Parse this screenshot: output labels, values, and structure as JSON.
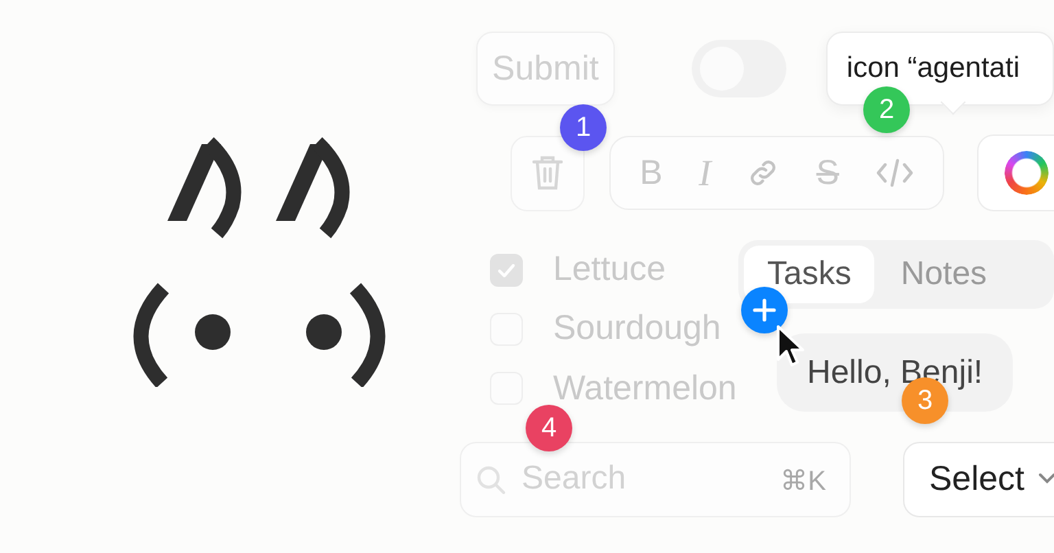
{
  "submit_button": {
    "label": "Submit"
  },
  "toggle": {
    "on": false
  },
  "tooltip": {
    "text": "icon “agentati"
  },
  "toolbar": [
    {
      "kind": "bold",
      "label": "B"
    },
    {
      "kind": "italic",
      "label": "I"
    },
    {
      "kind": "link"
    },
    {
      "kind": "strike",
      "label": "S"
    },
    {
      "kind": "code"
    }
  ],
  "checklist": [
    {
      "label": "Lettuce",
      "checked": true
    },
    {
      "label": "Sourdough",
      "checked": false
    },
    {
      "label": "Watermelon",
      "checked": false
    }
  ],
  "tabs": [
    {
      "label": "Tasks",
      "selected": true
    },
    {
      "label": "Notes",
      "selected": false
    }
  ],
  "chat_bubble": {
    "text": "Hello, Benji!"
  },
  "search": {
    "placeholder": "Search",
    "shortcut": "⌘K"
  },
  "select": {
    "label": "Select"
  },
  "markers": [
    {
      "label": "1",
      "color": "#5b55f0"
    },
    {
      "label": "2",
      "color": "#34c759"
    },
    {
      "label": "3",
      "color": "#f7902a"
    },
    {
      "label": "4",
      "color": "#e94262"
    }
  ]
}
